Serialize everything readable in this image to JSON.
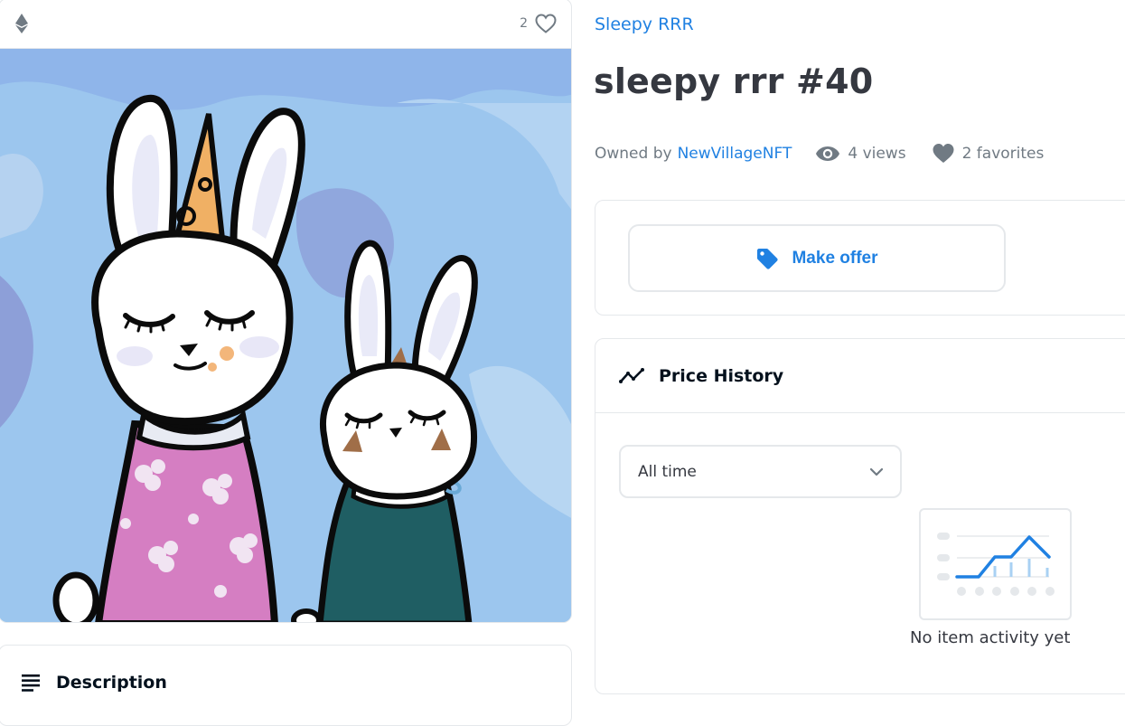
{
  "media": {
    "favorite_count": "2",
    "chain_icon": "ethereum-icon",
    "favorite_icon": "heart-outline-icon"
  },
  "description": {
    "title": "Description",
    "icon": "list-lines-icon"
  },
  "item": {
    "collection_name": "Sleepy RRR",
    "title": "sleepy rrr #40",
    "owned_by_label": "Owned by",
    "owner_name": "NewVillageNFT",
    "views_label": "4 views",
    "favorites_label": "2 favorites"
  },
  "offer": {
    "button_label": "Make offer",
    "icon": "tag-icon"
  },
  "price_history": {
    "title": "Price History",
    "icon": "trend-line-icon",
    "range_selected": "All time",
    "empty_message": "No item activity yet"
  },
  "colors": {
    "accent": "#2081e2",
    "text": "#353840",
    "muted": "#707a83",
    "border": "#e5e8eb",
    "art_background": "#9cc6ee"
  }
}
